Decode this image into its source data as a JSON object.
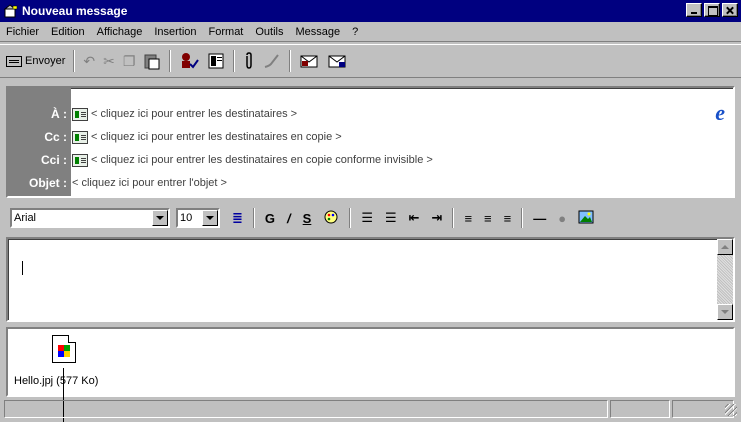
{
  "window": {
    "title": "Nouveau message",
    "icon": "new-message-icon"
  },
  "menu": [
    "Fichier",
    "Edition",
    "Affichage",
    "Insertion",
    "Format",
    "Outils",
    "Message",
    "?"
  ],
  "toolbar": {
    "send_label": "Envoyer",
    "icons": [
      "undo-icon",
      "cut-icon",
      "copy-icon",
      "paste-icon",
      "check-names-icon",
      "address-book-icon",
      "attach-icon",
      "sign-icon",
      "encrypt-icon",
      "mail-icon"
    ]
  },
  "header": {
    "to_label": "À :",
    "to_value": "< cliquez ici pour entrer les destinataires >",
    "cc_label": "Cc :",
    "cc_value": "< cliquez ici pour entrer les destinataires en copie >",
    "bcc_label": "Cci :",
    "bcc_value": "< cliquez ici pour entrer les destinataires en copie conforme invisible >",
    "subject_label": "Objet :",
    "subject_value": "< cliquez ici pour entrer l'objet >"
  },
  "format": {
    "font_name": "Arial",
    "font_size": "10",
    "bold": "G",
    "italic": "/",
    "underline": "S"
  },
  "body": {
    "text": ""
  },
  "attachment": {
    "label": "Hello.jpj (577 Ko)"
  },
  "colors": {
    "titlebar": "#000080",
    "face": "#c0c0c0",
    "ie_blue": "#1850c8"
  }
}
